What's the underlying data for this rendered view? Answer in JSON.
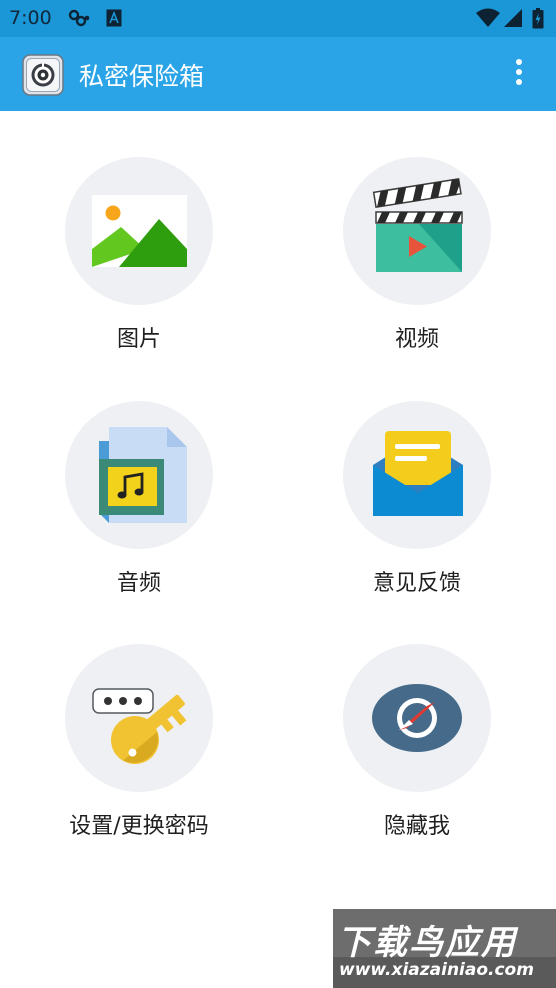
{
  "status_bar": {
    "time": "7:00"
  },
  "app_bar": {
    "title": "私密保险箱"
  },
  "tiles": [
    {
      "label": "图片",
      "icon": "picture-icon"
    },
    {
      "label": "视频",
      "icon": "clapperboard-icon"
    },
    {
      "label": "音频",
      "icon": "music-file-icon"
    },
    {
      "label": "意见反馈",
      "icon": "envelope-icon"
    },
    {
      "label": "设置/更换密码",
      "icon": "key-password-icon"
    },
    {
      "label": "隐藏我",
      "icon": "compass-icon"
    }
  ],
  "watermark": {
    "title": "下载鸟应用",
    "url": "www.xiazainiao.com"
  },
  "colors": {
    "status_bar": "#1b96d6",
    "app_bar": "#2aa4e6",
    "tile_circle": "#eef0f3"
  }
}
